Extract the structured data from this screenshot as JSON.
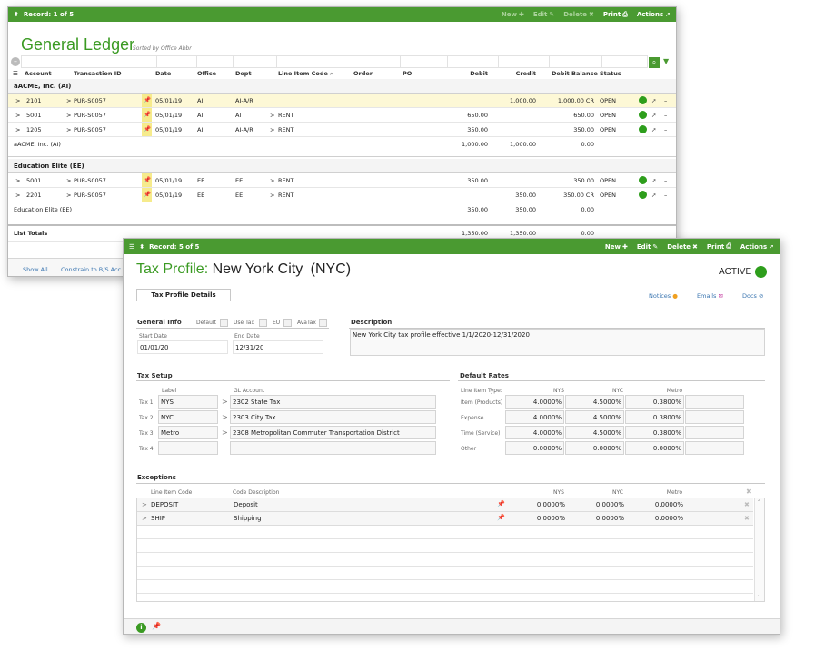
{
  "gl": {
    "record": "Record: 1 of 5",
    "toolbar": {
      "new": "New",
      "edit": "Edit",
      "delete": "Delete",
      "print": "Print",
      "actions": "Actions"
    },
    "title": "General Ledger",
    "subtitle": "Sorted by Office Abbr",
    "columns": {
      "account": "Account",
      "transaction": "Transaction ID",
      "date": "Date",
      "office": "Office",
      "dept": "Dept",
      "lic": "Line Item Code",
      "order": "Order",
      "po": "PO",
      "debit": "Debit",
      "credit": "Credit",
      "balance": "Debit Balance",
      "status": "Status"
    },
    "groups": [
      {
        "name": "aACME, Inc. (AI)",
        "rows": [
          {
            "account": "2101",
            "trans": "PUR-S0057",
            "date": "05/01/19",
            "office": "AI",
            "dept": "AI-A/R",
            "lic": "",
            "debit": "",
            "credit": "1,000.00",
            "balance": "1,000.00 CR",
            "status": "OPEN"
          },
          {
            "account": "5001",
            "trans": "PUR-S0057",
            "date": "05/01/19",
            "office": "AI",
            "dept": "AI",
            "lic": "RENT",
            "debit": "650.00",
            "credit": "",
            "balance": "650.00",
            "status": "OPEN"
          },
          {
            "account": "1205",
            "trans": "PUR-S0057",
            "date": "05/01/19",
            "office": "AI",
            "dept": "AI-A/R",
            "lic": "RENT",
            "debit": "350.00",
            "credit": "",
            "balance": "350.00",
            "status": "OPEN"
          }
        ],
        "subtotal": {
          "label": "aACME, Inc. (AI)",
          "debit": "1,000.00",
          "credit": "1,000.00",
          "balance": "0.00"
        }
      },
      {
        "name": "Education Elite (EE)",
        "rows": [
          {
            "account": "5001",
            "trans": "PUR-S0057",
            "date": "05/01/19",
            "office": "EE",
            "dept": "EE",
            "lic": "RENT",
            "debit": "350.00",
            "credit": "",
            "balance": "350.00",
            "status": "OPEN"
          },
          {
            "account": "2201",
            "trans": "PUR-S0057",
            "date": "05/01/19",
            "office": "EE",
            "dept": "EE",
            "lic": "RENT",
            "debit": "",
            "credit": "350.00",
            "balance": "350.00 CR",
            "status": "OPEN"
          }
        ],
        "subtotal": {
          "label": "Education Elite (EE)",
          "debit": "350.00",
          "credit": "350.00",
          "balance": "0.00"
        }
      }
    ],
    "totals": {
      "label": "List Totals",
      "debit": "1,350.00",
      "credit": "1,350.00",
      "balance": "0.00"
    },
    "footer": {
      "show_all": "Show All",
      "constrain": "Constrain to B/S Acc"
    }
  },
  "tp": {
    "record": "Record: 5 of 5",
    "toolbar": {
      "new": "New",
      "edit": "Edit",
      "delete": "Delete",
      "print": "Print",
      "actions": "Actions"
    },
    "title_prefix": "Tax Profile:",
    "title_name": "New York City",
    "title_code": "(NYC)",
    "status": "ACTIVE",
    "tab": "Tax Profile Details",
    "links": {
      "notices": "Notices",
      "emails": "Emails",
      "docs": "Docs"
    },
    "general": {
      "title": "General Info",
      "default": "Default",
      "use_tax": "Use Tax",
      "eu": "EU",
      "avatax": "AvaTax",
      "start_label": "Start Date",
      "start": "01/01/20",
      "end_label": "End Date",
      "end": "12/31/20"
    },
    "description": {
      "title": "Description",
      "text": "New York City tax profile effective 1/1/2020-12/31/2020"
    },
    "tax_setup": {
      "title": "Tax Setup",
      "label_hdr": "Label",
      "gl_hdr": "GL Account",
      "rows": [
        {
          "tax": "Tax 1",
          "label": "NYS",
          "gl": "2302 State Tax"
        },
        {
          "tax": "Tax 2",
          "label": "NYC",
          "gl": "2303 City Tax"
        },
        {
          "tax": "Tax 3",
          "label": "Metro",
          "gl": "2308 Metropolitan Commuter Transportation District"
        },
        {
          "tax": "Tax 4",
          "label": "",
          "gl": ""
        }
      ]
    },
    "rates": {
      "title": "Default Rates",
      "type_hdr": "Line Item Type:",
      "cols": [
        "NYS",
        "NYC",
        "Metro"
      ],
      "rows": [
        {
          "type": "Item (Products)",
          "vals": [
            "4.0000%",
            "4.5000%",
            "0.3800%"
          ]
        },
        {
          "type": "Expense",
          "vals": [
            "4.0000%",
            "4.5000%",
            "0.3800%"
          ]
        },
        {
          "type": "Time (Service)",
          "vals": [
            "4.0000%",
            "4.5000%",
            "0.3800%"
          ]
        },
        {
          "type": "Other",
          "vals": [
            "0.0000%",
            "0.0000%",
            "0.0000%"
          ]
        }
      ]
    },
    "exceptions": {
      "title": "Exceptions",
      "code_hdr": "Line Item Code",
      "desc_hdr": "Code Description",
      "cols": [
        "NYS",
        "NYC",
        "Metro"
      ],
      "rows": [
        {
          "code": "DEPOSIT",
          "desc": "Deposit",
          "vals": [
            "0.0000%",
            "0.0000%",
            "0.0000%"
          ]
        },
        {
          "code": "SHIP",
          "desc": "Shipping",
          "vals": [
            "0.0000%",
            "0.0000%",
            "0.0000%"
          ]
        }
      ]
    }
  },
  "colors": {
    "green": "#4a9a31",
    "title_green": "#3a9a22",
    "pin_yellow": "#f6eb8c",
    "status_green": "#2e9e1c"
  }
}
